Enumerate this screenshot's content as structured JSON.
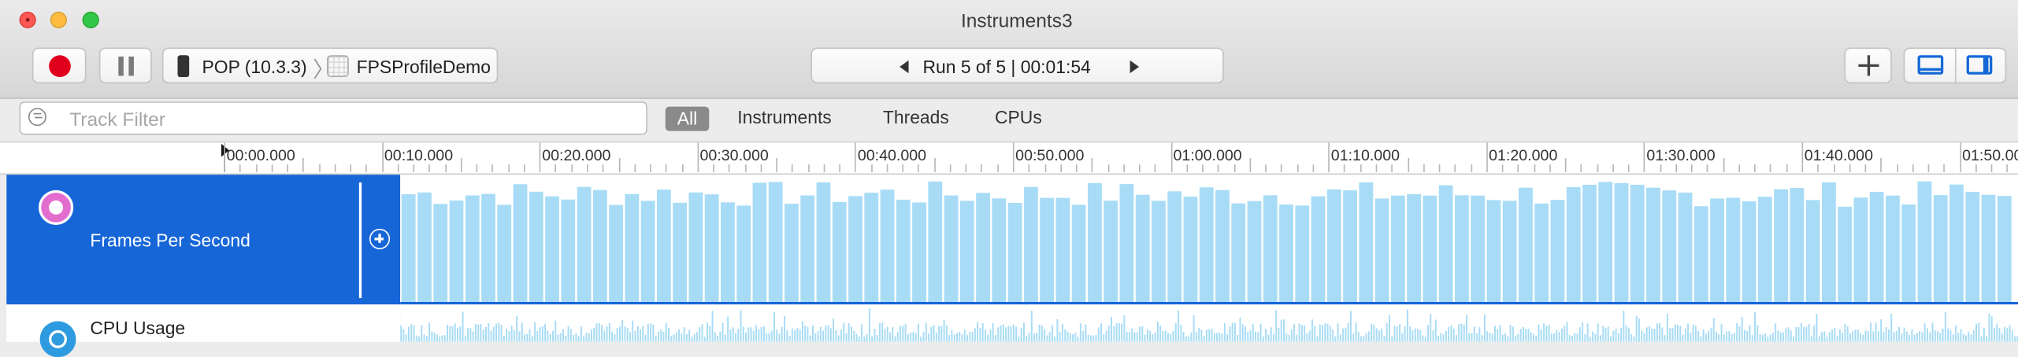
{
  "window": {
    "title": "Instruments3"
  },
  "toolbar": {
    "device_label": "POP (10.3.3)",
    "app_label": "FPSProfileDemo",
    "run_label": "Run 5 of 5  |  00:01:54"
  },
  "filterbar": {
    "placeholder": "Track Filter",
    "tabs": [
      "All",
      "Instruments",
      "Threads",
      "CPUs"
    ],
    "selected": "All"
  },
  "ruler": {
    "labels": [
      "00:00.000",
      "00:10.000",
      "00:20.000",
      "00:30.000",
      "00:40.000",
      "00:50.000",
      "01:00.000",
      "01:10.000",
      "01:20.000",
      "01:30.000",
      "01:40.000",
      "01:50.000"
    ]
  },
  "tracks": [
    {
      "name": "Frames Per Second",
      "selected": true,
      "icon": "fps-icon"
    },
    {
      "name": "CPU Usage",
      "selected": false,
      "icon": "cpu-icon"
    }
  ],
  "colors": {
    "selection": "#1666d8",
    "bar": "#a8dcf6",
    "record": "#e0001d"
  }
}
